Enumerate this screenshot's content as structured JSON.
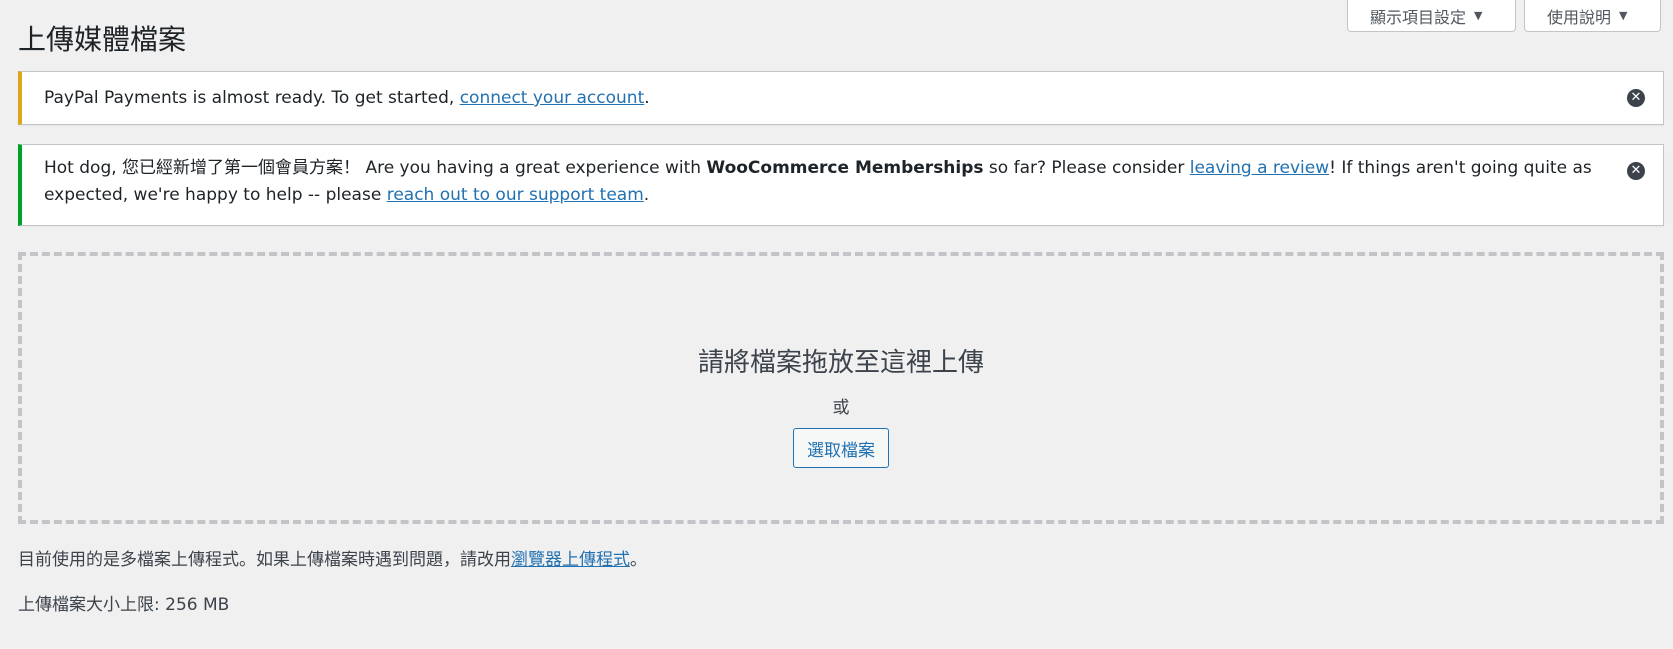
{
  "screen_meta": {
    "screen_options_label": "顯示項目設定",
    "help_label": "使用說明"
  },
  "page_title": "上傳媒體檔案",
  "notices": {
    "paypal": {
      "text_before": "PayPal Payments is almost ready. To get started, ",
      "link": "connect your account",
      "text_after": "."
    },
    "memberships": {
      "text1": "Hot dog, 您已經新增了第一個會員方案！ Are you having a great experience with ",
      "bold": "WooCommerce Memberships",
      "text2": " so far? Please consider ",
      "link1": "leaving a review",
      "text3": "! If things aren't going quite as expected, we're happy to help -- please ",
      "link2": "reach out to our support team",
      "text4": "."
    }
  },
  "uploader": {
    "drop_title": "請將檔案拖放至這裡上傳",
    "or_text": "或",
    "select_button": "選取檔案"
  },
  "info": {
    "uploader_note_before": "目前使用的是多檔案上傳程式。如果上傳檔案時遇到問題，請改用",
    "uploader_link": "瀏覽器上傳程式",
    "uploader_note_after": "。",
    "max_size": "上傳檔案大小上限: 256 MB"
  },
  "colors": {
    "accent": "#2271b1",
    "notice_warning": "#dba617",
    "notice_success": "#00a32a",
    "background": "#f0f0f1"
  },
  "icons": {
    "dismiss": "dismiss-icon",
    "dropdown": "triangle-down-icon"
  }
}
